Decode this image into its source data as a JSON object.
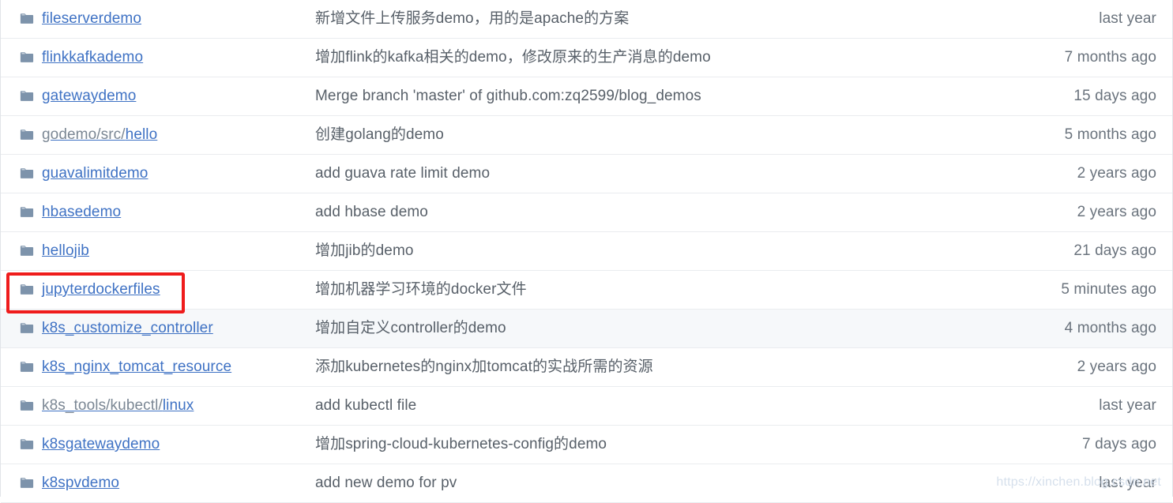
{
  "colors": {
    "link": "#3f72c4",
    "muted_text": "#586069",
    "age_text": "#6a737d",
    "folder_icon": "#7d93ab",
    "row_border": "#eaecef",
    "row_highlight_bg": "#f6f8fa",
    "annotation": "#ef1c1c",
    "watermark": "#d6e0ec"
  },
  "annotation": {
    "target_row_index": 8,
    "shape": "rectangle",
    "label": "jupyterdockerfiles"
  },
  "watermark": {
    "text": "https://xinchen.blog.csdn.net"
  },
  "icons": {
    "folder": "folder-icon"
  },
  "file_table": {
    "rows": [
      {
        "name": "fileserverdemo",
        "path_prefix": "",
        "message": "新增文件上传服务demo，用的是apache的方案",
        "age": "last year",
        "highlighted": false
      },
      {
        "name": "flinkkafkademo",
        "path_prefix": "",
        "message": "增加flink的kafka相关的demo，修改原来的生产消息的demo",
        "age": "7 months ago",
        "highlighted": false
      },
      {
        "name": "gatewaydemo",
        "path_prefix": "",
        "message": "Merge branch 'master' of github.com:zq2599/blog_demos",
        "age": "15 days ago",
        "highlighted": false
      },
      {
        "name": "hello",
        "path_prefix": "godemo/src/",
        "message": "创建golang的demo",
        "age": "5 months ago",
        "highlighted": false
      },
      {
        "name": "guavalimitdemo",
        "path_prefix": "",
        "message": "add guava rate limit demo",
        "age": "2 years ago",
        "highlighted": false
      },
      {
        "name": "hbasedemo",
        "path_prefix": "",
        "message": "add hbase demo",
        "age": "2 years ago",
        "highlighted": false
      },
      {
        "name": "hellojib",
        "path_prefix": "",
        "message": "增加jib的demo",
        "age": "21 days ago",
        "highlighted": false
      },
      {
        "name": "jupyterdockerfiles",
        "path_prefix": "",
        "message": "增加机器学习环境的docker文件",
        "age": "5 minutes ago",
        "highlighted": false
      },
      {
        "name": "k8s_customize_controller",
        "path_prefix": "",
        "message": "增加自定义controller的demo",
        "age": "4 months ago",
        "highlighted": true
      },
      {
        "name": "k8s_nginx_tomcat_resource",
        "path_prefix": "",
        "message": "添加kubernetes的nginx加tomcat的实战所需的资源",
        "age": "2 years ago",
        "highlighted": false
      },
      {
        "name": "linux",
        "path_prefix": "k8s_tools/kubectl/",
        "message": "add kubectl file",
        "age": "last year",
        "highlighted": false
      },
      {
        "name": "k8sgatewaydemo",
        "path_prefix": "",
        "message": "增加spring-cloud-kubernetes-config的demo",
        "age": "7 days ago",
        "highlighted": false
      },
      {
        "name": "k8spvdemo",
        "path_prefix": "",
        "message": "add new demo for pv",
        "age": "last year",
        "highlighted": false
      }
    ]
  }
}
